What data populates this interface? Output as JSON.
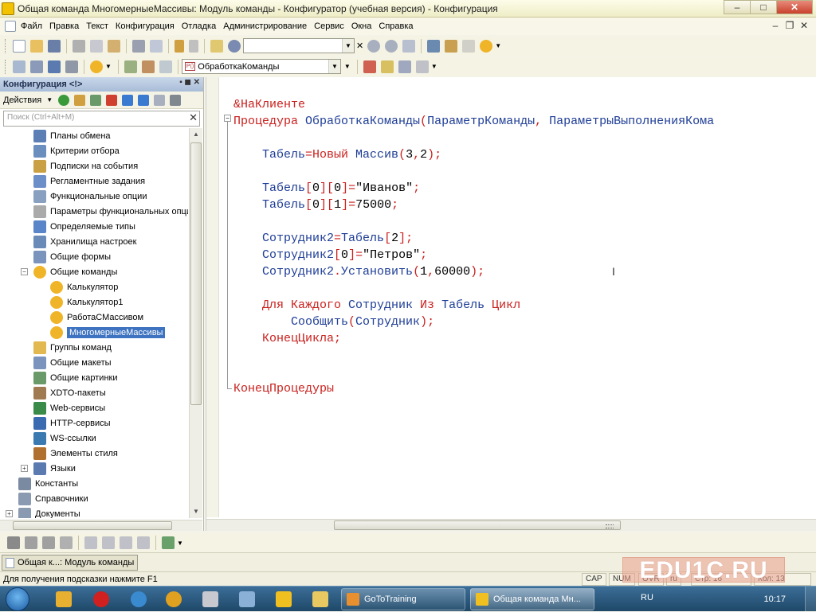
{
  "window": {
    "title": "Общая команда МногомерныеМассивы: Модуль команды - Конфигуратор (учебная версия) - Конфигурация",
    "buttons": [
      "–",
      "□",
      "✕"
    ]
  },
  "menu": {
    "items": [
      "Файл",
      "Правка",
      "Текст",
      "Конфигурация",
      "Отладка",
      "Администрирование",
      "Сервис",
      "Окна",
      "Справка"
    ]
  },
  "toolbar2": {
    "module_combo": "ОбработкаКоманды",
    "module_tag": "P()"
  },
  "left_panel": {
    "title": "Конфигурация <!>",
    "actions_label": "Действия",
    "search_placeholder": "Поиск (Ctrl+Alt+M)",
    "tree": [
      {
        "label": "Планы обмена",
        "icon": "exchange-plans-icon",
        "color": "#5b7fb5"
      },
      {
        "label": "Критерии отбора",
        "icon": "filter-criteria-icon",
        "color": "#6a8fbf"
      },
      {
        "label": "Подписки на события",
        "icon": "event-subscription-icon",
        "color": "#c9a043"
      },
      {
        "label": "Регламентные задания",
        "icon": "scheduled-jobs-icon",
        "color": "#6d8fc9"
      },
      {
        "label": "Функциональные опции",
        "icon": "functional-options-icon",
        "color": "#8aa0c0"
      },
      {
        "label": "Параметры функциональных опции",
        "icon": "functional-params-icon",
        "color": "#aaa"
      },
      {
        "label": "Определяемые типы",
        "icon": "defined-types-icon",
        "color": "#5a85c8"
      },
      {
        "label": "Хранилища настроек",
        "icon": "settings-storage-icon",
        "color": "#6a8ab8"
      },
      {
        "label": "Общие формы",
        "icon": "common-forms-icon",
        "color": "#7a94bd"
      },
      {
        "label": "Общие команды",
        "icon": "common-commands-icon",
        "color": "#f0b429",
        "expanded": true
      },
      {
        "label": "Калькулятор",
        "icon": "command-icon",
        "color": "#f0b429",
        "child": true
      },
      {
        "label": "Калькулятор1",
        "icon": "command-icon",
        "color": "#f0b429",
        "child": true
      },
      {
        "label": "РаботаСМассивом",
        "icon": "command-icon",
        "color": "#f0b429",
        "child": true
      },
      {
        "label": "МногомерныеМассивы",
        "icon": "command-icon",
        "color": "#f0b429",
        "child": true,
        "selected": true
      },
      {
        "label": "Группы команд",
        "icon": "command-groups-icon",
        "color": "#e2b850"
      },
      {
        "label": "Общие макеты",
        "icon": "common-templates-icon",
        "color": "#7a94bd"
      },
      {
        "label": "Общие картинки",
        "icon": "common-pictures-icon",
        "color": "#6a9a6a"
      },
      {
        "label": "XDTO-пакеты",
        "icon": "xdto-packages-icon",
        "color": "#a07a50"
      },
      {
        "label": "Web-сервисы",
        "icon": "web-services-icon",
        "color": "#3a8a4a"
      },
      {
        "label": "HTTP-сервисы",
        "icon": "http-services-icon",
        "color": "#3a6ab0"
      },
      {
        "label": "WS-ссылки",
        "icon": "ws-links-icon",
        "color": "#3a7ab0"
      },
      {
        "label": "Элементы стиля",
        "icon": "style-items-icon",
        "color": "#b07030"
      },
      {
        "label": "Языки",
        "icon": "languages-icon",
        "color": "#5a7ab0",
        "collapsed": true,
        "level": 1
      },
      {
        "label": "Константы",
        "icon": "constants-icon",
        "color": "#7a8aa0",
        "level": 0
      },
      {
        "label": "Справочники",
        "icon": "catalogs-icon",
        "color": "#8a9ab0",
        "level": 0
      },
      {
        "label": "Документы",
        "icon": "documents-icon",
        "color": "#8a9ab0",
        "collapsed": true,
        "level": 0
      }
    ]
  },
  "code": {
    "lines": [
      [
        {
          "t": "&НаКлиенте",
          "c": "pu"
        }
      ],
      [
        {
          "t": "Процедура ",
          "c": "kw"
        },
        {
          "t": "ОбработкаКоманды",
          "c": "id"
        },
        {
          "t": "(",
          "c": "pu"
        },
        {
          "t": "ПараметрКоманды",
          "c": "id"
        },
        {
          "t": ", ",
          "c": "pu"
        },
        {
          "t": "ПараметрыВыполненияКома",
          "c": "id"
        }
      ],
      [],
      [
        {
          "t": "    Табель",
          "c": "id"
        },
        {
          "t": "=",
          "c": "pu"
        },
        {
          "t": "Новый ",
          "c": "kw"
        },
        {
          "t": "Массив",
          "c": "id"
        },
        {
          "t": "(",
          "c": "pu"
        },
        {
          "t": "3",
          "c": "st"
        },
        {
          "t": ",",
          "c": "pu"
        },
        {
          "t": "2",
          "c": "st"
        },
        {
          "t": ");",
          "c": "pu"
        }
      ],
      [],
      [
        {
          "t": "    Табель",
          "c": "id"
        },
        {
          "t": "[",
          "c": "pu"
        },
        {
          "t": "0",
          "c": "st"
        },
        {
          "t": "][",
          "c": "pu"
        },
        {
          "t": "0",
          "c": "st"
        },
        {
          "t": "]=",
          "c": "pu"
        },
        {
          "t": "\"Иванов\"",
          "c": "st"
        },
        {
          "t": ";",
          "c": "pu"
        }
      ],
      [
        {
          "t": "    Табель",
          "c": "id"
        },
        {
          "t": "[",
          "c": "pu"
        },
        {
          "t": "0",
          "c": "st"
        },
        {
          "t": "][",
          "c": "pu"
        },
        {
          "t": "1",
          "c": "st"
        },
        {
          "t": "]=",
          "c": "pu"
        },
        {
          "t": "75000",
          "c": "st"
        },
        {
          "t": ";",
          "c": "pu"
        }
      ],
      [],
      [
        {
          "t": "    Сотрудник2",
          "c": "id"
        },
        {
          "t": "=",
          "c": "pu"
        },
        {
          "t": "Табель",
          "c": "id"
        },
        {
          "t": "[",
          "c": "pu"
        },
        {
          "t": "2",
          "c": "st"
        },
        {
          "t": "];",
          "c": "pu"
        }
      ],
      [
        {
          "t": "    Сотрудник2",
          "c": "id"
        },
        {
          "t": "[",
          "c": "pu"
        },
        {
          "t": "0",
          "c": "st"
        },
        {
          "t": "]=",
          "c": "pu"
        },
        {
          "t": "\"Петров\"",
          "c": "st"
        },
        {
          "t": ";",
          "c": "pu"
        }
      ],
      [
        {
          "t": "    Сотрудник2",
          "c": "id"
        },
        {
          "t": ".",
          "c": "pu"
        },
        {
          "t": "Установить",
          "c": "id"
        },
        {
          "t": "(",
          "c": "pu"
        },
        {
          "t": "1",
          "c": "st"
        },
        {
          "t": ",",
          "c": "pu"
        },
        {
          "t": "60000",
          "c": "st"
        },
        {
          "t": ");",
          "c": "pu"
        }
      ],
      [],
      [
        {
          "t": "    Для Каждого ",
          "c": "kw"
        },
        {
          "t": "Сотрудник ",
          "c": "id"
        },
        {
          "t": "Из ",
          "c": "kw"
        },
        {
          "t": "Табель ",
          "c": "id"
        },
        {
          "t": "Цикл",
          "c": "kw"
        }
      ],
      [
        {
          "t": "        Сообщить",
          "c": "id"
        },
        {
          "t": "(",
          "c": "pu"
        },
        {
          "t": "Сотрудник",
          "c": "id"
        },
        {
          "t": ");",
          "c": "pu"
        }
      ],
      [
        {
          "t": "    КонецЦикла",
          "c": "kw"
        },
        {
          "t": ";",
          "c": "pu"
        }
      ],
      [],
      [],
      [
        {
          "t": "КонецПроцедуры",
          "c": "kw"
        }
      ]
    ]
  },
  "window_tab": {
    "label": "Общая к...: Модуль команды"
  },
  "status": {
    "hint": "Для получения подсказки нажмите F1",
    "cap": "CAP",
    "num": "NUM",
    "ovr": "OVR",
    "lang": "ru",
    "line": "Стр: 16",
    "col": "Кол: 13"
  },
  "watermark": "EDU1C.RU",
  "taskbar": {
    "tasks": [
      {
        "label": "GoToTraining",
        "icon": "gototraining-icon"
      },
      {
        "label": "Общая команда Мн...",
        "icon": "1c-configurator-icon",
        "active": true
      }
    ],
    "lang": "RU",
    "time": "10:17"
  },
  "colors": {
    "keyword": "#c9211e",
    "identifier": "#1e3d96",
    "selection": "#3d73c0"
  }
}
